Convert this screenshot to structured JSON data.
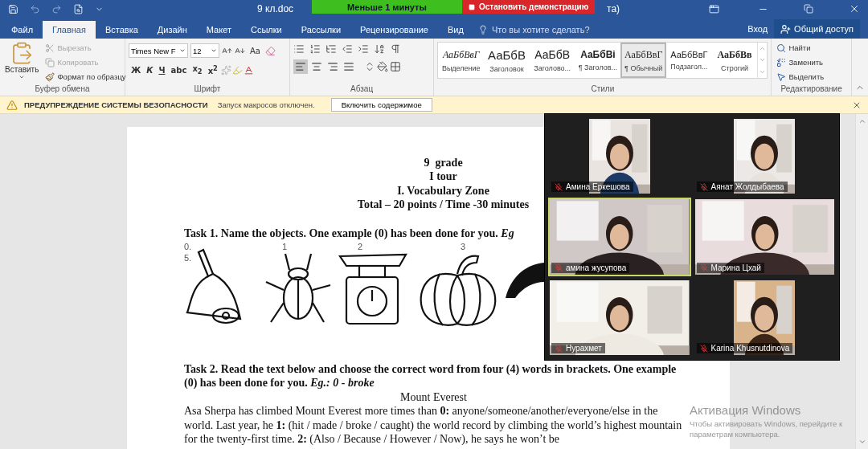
{
  "title_bar": {
    "document": "9 кл.doc",
    "title_tail": "та)"
  },
  "share_bar": {
    "timer": "Меньше 1 минуты",
    "stop": "Остановить демонстрацию"
  },
  "tabs": [
    {
      "label": "Файл",
      "selected": false
    },
    {
      "label": "Главная",
      "selected": true
    },
    {
      "label": "Вставка",
      "selected": false
    },
    {
      "label": "Дизайн",
      "selected": false
    },
    {
      "label": "Макет",
      "selected": false
    },
    {
      "label": "Ссылки",
      "selected": false
    },
    {
      "label": "Рассылки",
      "selected": false
    },
    {
      "label": "Рецензирование",
      "selected": false
    },
    {
      "label": "Вид",
      "selected": false
    }
  ],
  "tell_me": {
    "placeholder": "Что вы хотите сделать?"
  },
  "sign_in": "Вход",
  "share": "Общий доступ",
  "clipboard": {
    "group": "Буфер обмена",
    "paste": "Вставить",
    "items": [
      {
        "label": "Вырезать",
        "kind": "cut",
        "disabled": true
      },
      {
        "label": "Копировать",
        "kind": "copy",
        "disabled": true
      },
      {
        "label": "Формат по образцу",
        "kind": "painter",
        "disabled": false
      }
    ]
  },
  "font": {
    "group": "Шрифт",
    "name": "Times New F",
    "size": "12",
    "case": "Aa",
    "format_buttons": [
      "Ж",
      "К",
      "Ч",
      "abc",
      "x$_{2}$",
      "x$^{2}$"
    ]
  },
  "paragraph": {
    "group": "Абзац",
    "align": [
      {
        "selected": true
      },
      {
        "selected": false
      },
      {
        "selected": false
      },
      {
        "selected": false
      }
    ]
  },
  "styles": {
    "group": "Стили",
    "items": [
      {
        "preview": "АаБбВвГ",
        "label": "Выделение",
        "kind": "emphasis",
        "selected": false
      },
      {
        "preview": "АаБбВ",
        "label": "Заголовок",
        "kind": "title",
        "selected": false
      },
      {
        "preview": "АаБбВ",
        "label": "Заголово...",
        "kind": "heading",
        "selected": false
      },
      {
        "preview": "АаБбВі",
        "label": "¶ Заголов...",
        "kind": "heading_bold",
        "selected": false
      },
      {
        "preview": "АаБбВвГ",
        "label": "¶ Обычный",
        "kind": "normal",
        "selected": true
      },
      {
        "preview": "АаБбВвГ",
        "label": "Подзагол...",
        "kind": "subtitle",
        "selected": false
      },
      {
        "preview": "АаБбВв",
        "label": "Строгий",
        "kind": "strong",
        "selected": false
      }
    ]
  },
  "editing": {
    "group": "Редактирование",
    "items": [
      {
        "label": "Найти",
        "kind": "find"
      },
      {
        "label": "Заменить",
        "kind": "replace"
      },
      {
        "label": "Выделить",
        "kind": "select"
      }
    ]
  },
  "security_bar": {
    "title": "ПРЕДУПРЕЖДЕНИЕ СИСТЕМЫ БЕЗОПАСНОСТИ",
    "message": "Запуск макросов отключен.",
    "button": "Включить содержимое"
  },
  "document": {
    "heading": [
      "9  grade",
      "I tour",
      "I. Vocabulary Zone",
      "Total – 20 points / Time -30 minutes"
    ],
    "task1": "Task 1. Name the objects.  One example (0) has been done for you. *Eg*",
    "objects": [
      {
        "kind": "bell",
        "labels": [
          "0.",
          "5."
        ]
      },
      {
        "kind": "beetle",
        "labels": [
          "1"
        ]
      },
      {
        "kind": "scale",
        "labels": [
          "2"
        ]
      },
      {
        "kind": "pumpkin",
        "labels": [
          "3"
        ]
      },
      {
        "kind": "bird"
      }
    ],
    "task2": "Task 2. Read the text below and choose the correct word from four (4) words in brackets. One example (0) has been done for you. *Eg.:  0 - broke*",
    "text_title": "Mount Everest",
    "text": "Asa Sherpa has climbed Mount Everest more times than **0:** anyone/someone/another/everyone/else in the world. Last year, he **1:** (hit / made / broke / caught) the world record by climbing the world’s highest mountain for the twenty-first time. **2:** (Also / Because /  However / Now), he says he won’t be"
  },
  "meeting": {
    "participants": [
      {
        "name": "Амина Еркешова",
        "kind": "portrait",
        "muted": true,
        "speaking": false
      },
      {
        "name": "Аянат Жолдыбаева",
        "kind": "portrait",
        "muted": true,
        "speaking": false
      },
      {
        "name": "амина жусупова",
        "kind": "wide",
        "muted": true,
        "speaking": true
      },
      {
        "name": "Марина Цхай",
        "kind": "wide",
        "muted": true,
        "speaking": false
      },
      {
        "name": "Нурахмет",
        "kind": "wide",
        "muted": true,
        "speaking": false
      },
      {
        "name": "Karina Khusnutdinova",
        "kind": "portrait",
        "muted": true,
        "speaking": false
      }
    ]
  },
  "activation": {
    "title": "Активация Windows",
    "message": "Чтобы активировать Windows, перейдите к параметрам компьютера."
  }
}
